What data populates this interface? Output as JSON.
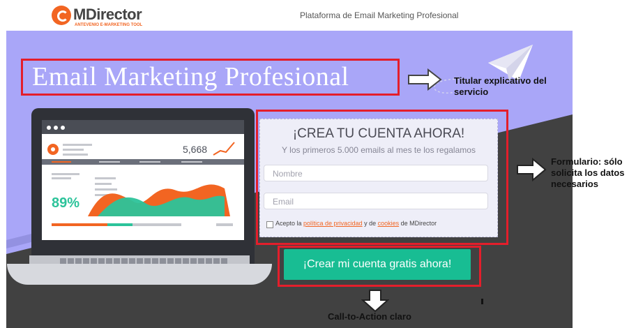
{
  "header": {
    "brand_name": "MDirector",
    "brand_tagline": "ANTEVENIO E-MARKETING TOOL",
    "tagline": "Plataforma de Email Marketing Profesional"
  },
  "hero": {
    "headline": "Email Marketing Profesional"
  },
  "laptop_mockup": {
    "metric_value": "5,668",
    "percent": "89%"
  },
  "form": {
    "title": "¡CREA TU CUENTA AHORA!",
    "subtitle": "Y los primeros 5.000 emails al mes te los regalamos",
    "name_placeholder": "Nombre",
    "email_placeholder": "Email",
    "legal_prefix": "Acepto la ",
    "legal_privacy_link": "política de privacidad",
    "legal_mid": " y de ",
    "legal_cookies_link": "cookies",
    "legal_suffix": " de MDirector"
  },
  "cta": {
    "label": "¡Crear mi cuenta gratis ahora!"
  },
  "annotations": {
    "headline_note_line1": "Titular explicativo del",
    "headline_note_line2": "servicio",
    "form_note_line1": "Formulario: sólo",
    "form_note_line2": "solicita los datos",
    "form_note_line3": "necesarios",
    "cta_note": "Call-to-Action claro"
  },
  "colors": {
    "hero_bg": "#a9a6f8",
    "dark_bg": "#414141",
    "accent_red": "#e41e2b",
    "brand_orange": "#f26522",
    "cta_green": "#18bd93"
  }
}
